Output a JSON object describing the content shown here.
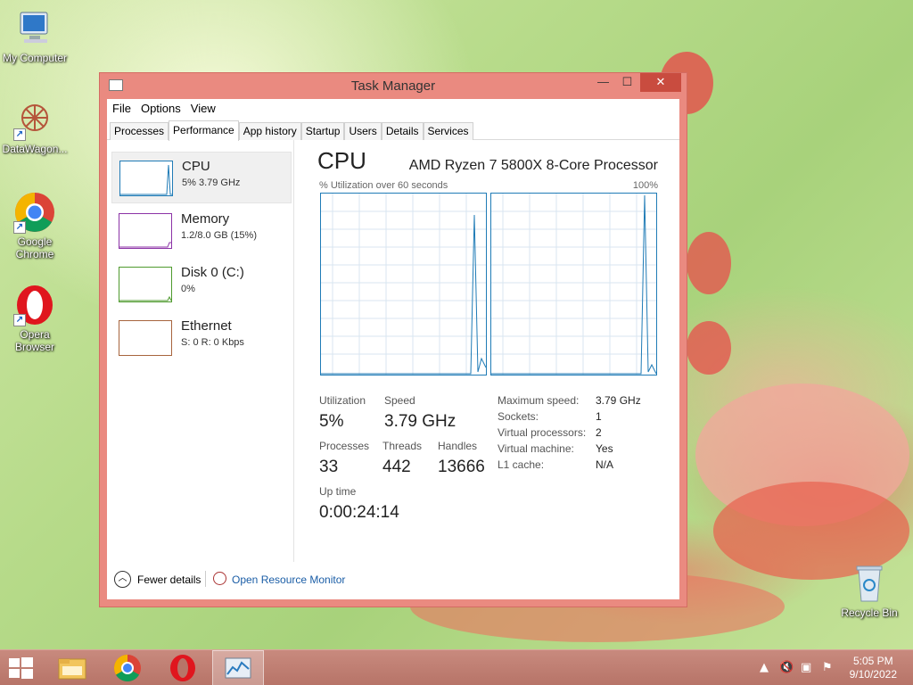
{
  "desktop": {
    "icons": [
      {
        "label": "My Computer",
        "icon": "computer-icon"
      },
      {
        "label": "DataWagon...",
        "icon": "datawagon-icon"
      },
      {
        "label": "Google Chrome",
        "icon": "chrome-icon"
      },
      {
        "label": "Opera Browser",
        "icon": "opera-icon"
      },
      {
        "label": "Recycle Bin",
        "icon": "recycle-bin-icon"
      }
    ]
  },
  "window": {
    "title": "Task Manager",
    "controls": {
      "minimize": "—",
      "maximize": "☐",
      "close": "✕"
    },
    "menu": [
      "File",
      "Options",
      "View"
    ],
    "tabs": [
      "Processes",
      "Performance",
      "App history",
      "Startup",
      "Users",
      "Details",
      "Services"
    ],
    "active_tab": "Performance"
  },
  "sidebar": {
    "items": [
      {
        "name": "CPU",
        "detail": "5%  3.79 GHz",
        "color": "#1f7bb6",
        "selected": true
      },
      {
        "name": "Memory",
        "detail": "1.2/8.0 GB (15%)",
        "color": "#8b32a6",
        "selected": false
      },
      {
        "name": "Disk 0 (C:)",
        "detail": "0%",
        "color": "#4f9a2e",
        "selected": false
      },
      {
        "name": "Ethernet",
        "detail": "S: 0 R: 0 Kbps",
        "color": "#a7643d",
        "selected": false
      }
    ]
  },
  "cpu": {
    "heading": "CPU",
    "processor": "AMD Ryzen 7 5800X 8-Core Processor",
    "graph_caption": "% Utilization over 60 seconds",
    "graph_max": "100%",
    "stats": {
      "utilization_label": "Utilization",
      "utilization": "5%",
      "speed_label": "Speed",
      "speed": "3.79 GHz",
      "processes_label": "Processes",
      "processes": "33",
      "threads_label": "Threads",
      "threads": "442",
      "handles_label": "Handles",
      "handles": "13666",
      "uptime_label": "Up time",
      "uptime": "0:00:24:14"
    },
    "specs": [
      {
        "label": "Maximum speed:",
        "value": "3.79 GHz"
      },
      {
        "label": "Sockets:",
        "value": "1"
      },
      {
        "label": "Virtual processors:",
        "value": "2"
      },
      {
        "label": "Virtual machine:",
        "value": "Yes"
      },
      {
        "label": "L1 cache:",
        "value": "N/A"
      }
    ]
  },
  "footer": {
    "fewer_details": "Fewer details",
    "resource_monitor": "Open Resource Monitor"
  },
  "taskbar": {
    "items": [
      "start-icon",
      "file-explorer-icon",
      "chrome-icon",
      "opera-icon",
      "task-manager-icon"
    ],
    "time": "5:05 PM",
    "date": "9/10/2022"
  }
}
